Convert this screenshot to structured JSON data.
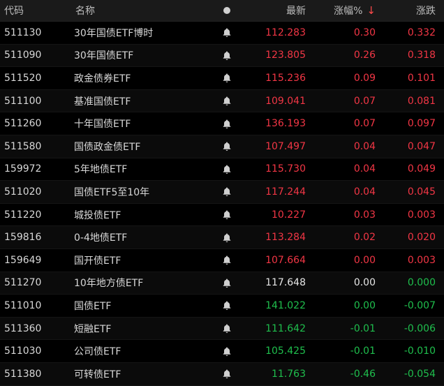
{
  "header": {
    "code": "代码",
    "name": "名称",
    "price": "最新",
    "change_pct": "涨幅%",
    "change_amt": "涨跌"
  },
  "colors": {
    "up": "#f23645",
    "down": "#1fbf4d",
    "flat": "#e6e6e6"
  },
  "rows": [
    {
      "code": "511130",
      "name": "30年国债ETF博时",
      "price": "112.283",
      "pct": "0.30",
      "amt": "0.332",
      "trend": "up"
    },
    {
      "code": "511090",
      "name": "30年国债ETF",
      "price": "123.805",
      "pct": "0.26",
      "amt": "0.318",
      "trend": "up"
    },
    {
      "code": "511520",
      "name": "政金债券ETF",
      "price": "115.236",
      "pct": "0.09",
      "amt": "0.101",
      "trend": "up"
    },
    {
      "code": "511100",
      "name": "基准国债ETF",
      "price": "109.041",
      "pct": "0.07",
      "amt": "0.081",
      "trend": "up"
    },
    {
      "code": "511260",
      "name": "十年国债ETF",
      "price": "136.193",
      "pct": "0.07",
      "amt": "0.097",
      "trend": "up"
    },
    {
      "code": "511580",
      "name": "国债政金债ETF",
      "price": "107.497",
      "pct": "0.04",
      "amt": "0.047",
      "trend": "up"
    },
    {
      "code": "159972",
      "name": "5年地债ETF",
      "price": "115.730",
      "pct": "0.04",
      "amt": "0.049",
      "trend": "up"
    },
    {
      "code": "511020",
      "name": "国债ETF5至10年",
      "price": "117.244",
      "pct": "0.04",
      "amt": "0.045",
      "trend": "up"
    },
    {
      "code": "511220",
      "name": "城投债ETF",
      "price": "10.227",
      "pct": "0.03",
      "amt": "0.003",
      "trend": "up"
    },
    {
      "code": "159816",
      "name": "0-4地债ETF",
      "price": "113.284",
      "pct": "0.02",
      "amt": "0.020",
      "trend": "up"
    },
    {
      "code": "159649",
      "name": "国开债ETF",
      "price": "107.664",
      "pct": "0.00",
      "amt": "0.003",
      "trend": "up"
    },
    {
      "code": "511270",
      "name": "10年地方债ETF",
      "price": "117.648",
      "pct": "0.00",
      "amt": "0.000",
      "trend": "flat",
      "amtTrend": "down"
    },
    {
      "code": "511010",
      "name": "国债ETF",
      "price": "141.022",
      "pct": "0.00",
      "amt": "-0.007",
      "trend": "down"
    },
    {
      "code": "511360",
      "name": "短融ETF",
      "price": "111.642",
      "pct": "-0.01",
      "amt": "-0.006",
      "trend": "down"
    },
    {
      "code": "511030",
      "name": "公司债ETF",
      "price": "105.425",
      "pct": "-0.01",
      "amt": "-0.010",
      "trend": "down"
    },
    {
      "code": "511380",
      "name": "可转债ETF",
      "price": "11.763",
      "pct": "-0.46",
      "amt": "-0.054",
      "trend": "down"
    }
  ]
}
